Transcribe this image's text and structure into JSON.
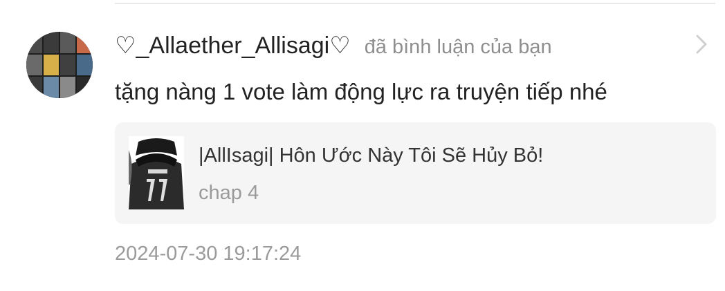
{
  "notification": {
    "username": "♡_Allaether_Allisagi♡",
    "action": "đã bình luận của bạn",
    "comment": "tặng nàng 1 vote làm động lực ra truyện tiếp nhé",
    "timestamp": "2024-07-30 19:17:24",
    "avatar_icon": "user-avatar",
    "chevron_icon": "chevron-right-icon"
  },
  "story": {
    "title": "|AllIsagi| Hôn Ước Này Tôi Sẽ Hủy Bỏ!",
    "chapter": "chap 4",
    "cover_icon": "story-cover-image"
  },
  "colors": {
    "primary_text": "#222222",
    "secondary_text": "#8e8e8e",
    "card_background": "#f5f5f5"
  }
}
